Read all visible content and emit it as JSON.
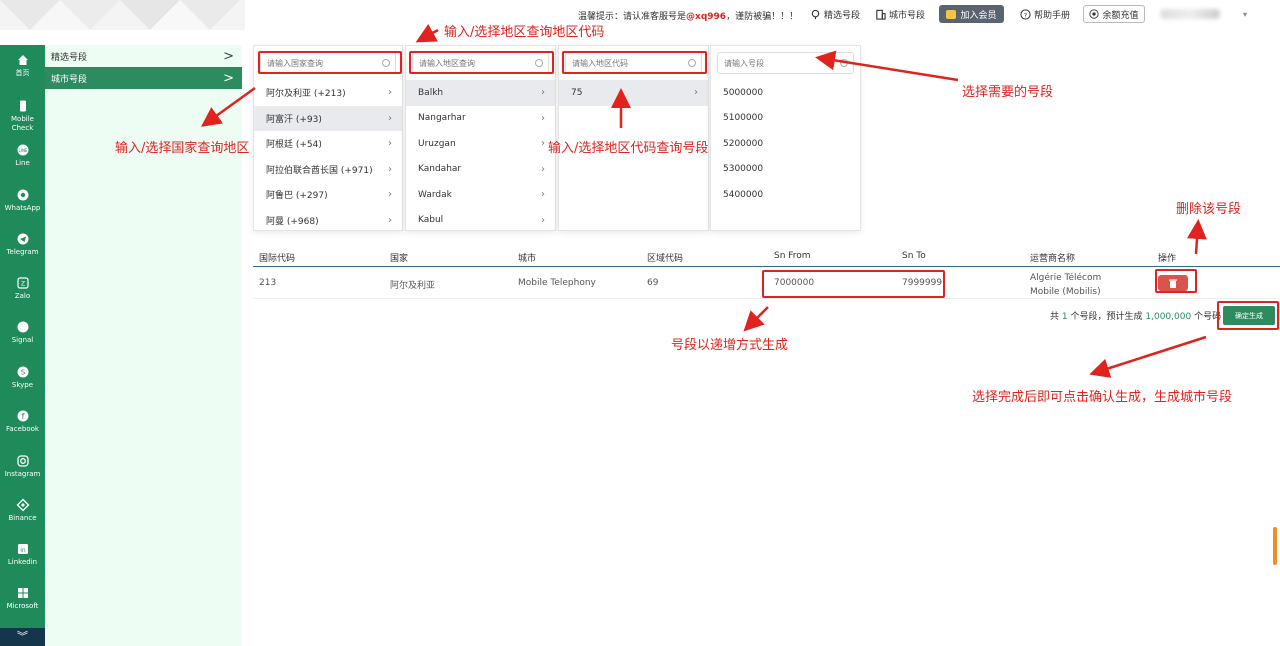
{
  "topbar": {
    "notice_prefix": "温馨提示：请认准客服号是",
    "notice_handle": "@xq996",
    "notice_suffix": "，谨防被骗！！！",
    "nav": [
      "精选号段",
      "城市号段"
    ],
    "join_label": "加入会员",
    "help_label": "帮助手册",
    "recharge_label": "余额充值"
  },
  "rail": [
    {
      "label": "首页",
      "icon": "home-icon"
    },
    {
      "label": "Mobile Check",
      "icon": "phone-icon"
    },
    {
      "label": "Line",
      "icon": "line-icon"
    },
    {
      "label": "WhatsApp",
      "icon": "whatsapp-icon"
    },
    {
      "label": "Telegram",
      "icon": "telegram-icon"
    },
    {
      "label": "Zalo",
      "icon": "zalo-icon"
    },
    {
      "label": "Signal",
      "icon": "signal-icon"
    },
    {
      "label": "Skype",
      "icon": "skype-icon"
    },
    {
      "label": "Facebook",
      "icon": "facebook-icon"
    },
    {
      "label": "Instagram",
      "icon": "instagram-icon"
    },
    {
      "label": "Binance",
      "icon": "binance-icon"
    },
    {
      "label": "Linkedin",
      "icon": "linkedin-icon"
    },
    {
      "label": "Microsoft",
      "icon": "microsoft-icon"
    }
  ],
  "subnav": [
    {
      "label": "精选号段",
      "active": false
    },
    {
      "label": "城市号段",
      "active": true
    }
  ],
  "cascader": {
    "country": {
      "placeholder": "请输入国家查询",
      "options": [
        "阿尔及利亚 (+213)",
        "阿富汗 (+93)",
        "阿根廷 (+54)",
        "阿拉伯联合酋长国 (+971)",
        "阿鲁巴 (+297)",
        "阿曼 (+968)"
      ],
      "selected_index": 1
    },
    "region": {
      "placeholder": "请输入地区查询",
      "options": [
        "Balkh",
        "Nangarhar",
        "Uruzgan",
        "Kandahar",
        "Wardak",
        "Kabul"
      ],
      "selected_index": 0
    },
    "area_code": {
      "placeholder": "请输入地区代码",
      "options": [
        "75"
      ],
      "selected_index": 0
    },
    "segment": {
      "placeholder": "请输入号段",
      "options": [
        "5000000",
        "5100000",
        "5200000",
        "5300000",
        "5400000"
      ]
    }
  },
  "table": {
    "headers": [
      "国际代码",
      "国家",
      "城市",
      "区域代码",
      "Sn From",
      "Sn To",
      "运营商名称",
      "操作"
    ],
    "row": {
      "intl_code": "213",
      "country": "阿尔及利亚",
      "city": "Mobile Telephony",
      "area_code": "69",
      "sn_from": "7000000",
      "sn_to": "7999999",
      "carrier": "Algérie Télécom Mobile (Mobilis)"
    }
  },
  "summary": {
    "prefix": "共",
    "count": "1",
    "middle": "个号段，预计生成",
    "total": "1,000,000",
    "suffix": "个号码"
  },
  "confirm_label": "确定生成",
  "annotations": {
    "country": "输入/选择国家查询地区",
    "region": "输入/选择地区查询地区代码",
    "area_code": "输入/选择地区代码查询号段",
    "segment": "选择需要的号段",
    "delete": "删除该号段",
    "increment": "号段以递增方式生成",
    "confirm": "选择完成后即可点击确认生成，生成城市号段"
  },
  "colors": {
    "accent": "#2e8b5f",
    "rail": "#1f8a5a",
    "annotation": "#e0231f",
    "delete": "#d9534f"
  }
}
